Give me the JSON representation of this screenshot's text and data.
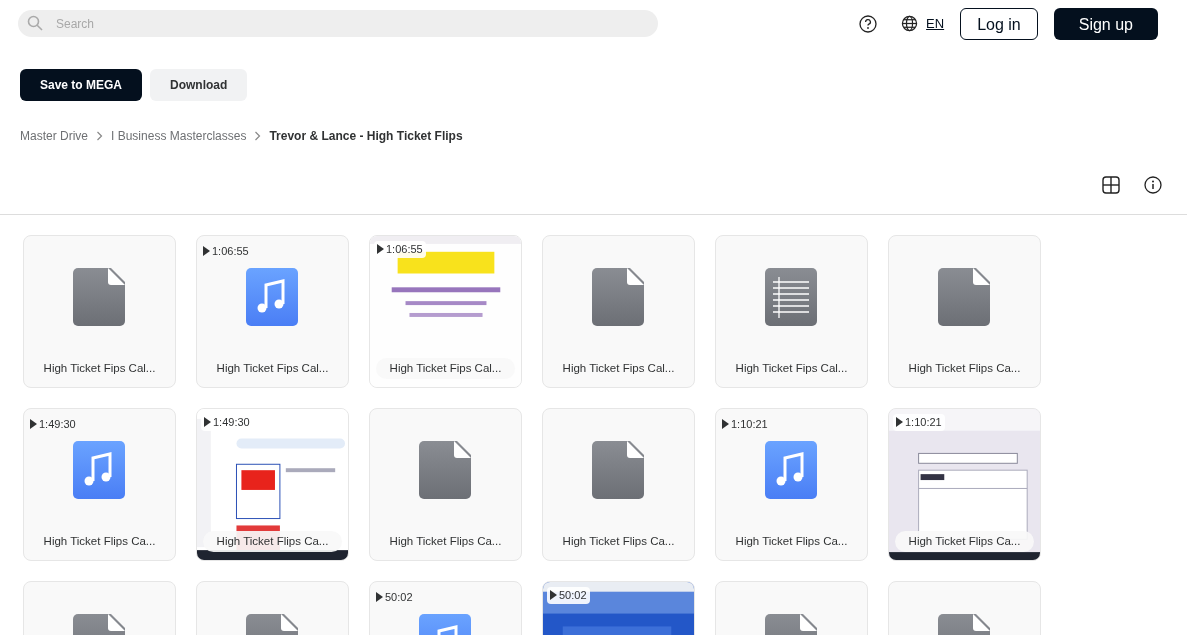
{
  "search": {
    "placeholder": "Search"
  },
  "header": {
    "language": "EN",
    "login": "Log in",
    "signup": "Sign up"
  },
  "actions": [
    "Save to MEGA",
    "Download"
  ],
  "breadcrumb": [
    "Master Drive",
    "I Business Masterclasses",
    "Trevor & Lance - High Ticket Flips"
  ],
  "files": [
    {
      "kind": "file",
      "name": "High Ticket Fips Cal..."
    },
    {
      "kind": "audio",
      "duration": "1:06:55",
      "name": "High Ticket Fips Cal..."
    },
    {
      "kind": "video",
      "duration": "1:06:55",
      "name": "High Ticket Fips Cal..."
    },
    {
      "kind": "file",
      "name": "High Ticket Fips Cal..."
    },
    {
      "kind": "text",
      "name": "High Ticket Fips Cal..."
    },
    {
      "kind": "file",
      "name": "High Ticket Flips Ca..."
    },
    {
      "kind": "audio",
      "duration": "1:49:30",
      "name": "High Ticket Flips Ca..."
    },
    {
      "kind": "video",
      "duration": "1:49:30",
      "name": "High Ticket Flips Ca..."
    },
    {
      "kind": "file",
      "name": "High Ticket Flips Ca..."
    },
    {
      "kind": "file",
      "name": "High Ticket Flips Ca..."
    },
    {
      "kind": "audio",
      "duration": "1:10:21",
      "name": "High Ticket Flips Ca..."
    },
    {
      "kind": "video",
      "duration": "1:10:21",
      "name": "High Ticket Flips Ca..."
    },
    {
      "kind": "file"
    },
    {
      "kind": "file"
    },
    {
      "kind": "audio",
      "duration": "50:02"
    },
    {
      "kind": "video",
      "duration": "50:02"
    },
    {
      "kind": "file"
    },
    {
      "kind": "file"
    }
  ]
}
